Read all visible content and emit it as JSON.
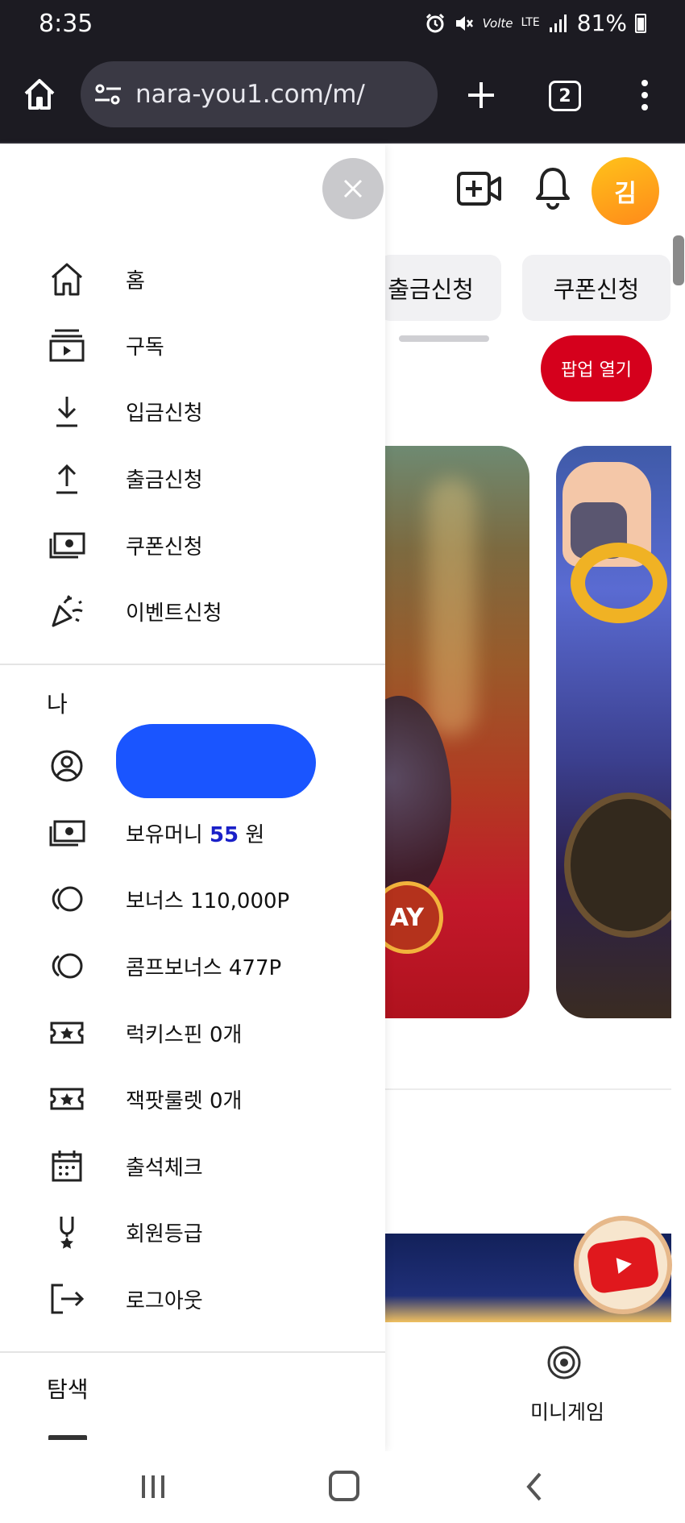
{
  "status_bar": {
    "time": "8:35",
    "battery": "81%",
    "network": "LTE",
    "volte": "Volte"
  },
  "browser": {
    "url": "nara-you1.com/m/",
    "tab_count": "2"
  },
  "header": {
    "avatar_initial": "김"
  },
  "chips": {
    "withdraw": "출금신청",
    "coupon": "쿠폰신청"
  },
  "popup_button": "팝업 열기",
  "banner": {
    "badge_text": "AY"
  },
  "bottom": {
    "mini_game": "미니게임"
  },
  "drawer": {
    "main_menu": [
      {
        "label": "홈",
        "icon": "home-icon"
      },
      {
        "label": "구독",
        "icon": "subscriptions-icon"
      },
      {
        "label": "입금신청",
        "icon": "download-icon"
      },
      {
        "label": "출금신청",
        "icon": "upload-icon"
      },
      {
        "label": "쿠폰신청",
        "icon": "money-icon"
      },
      {
        "label": "이벤트신청",
        "icon": "party-popper-icon"
      }
    ],
    "me_section": {
      "title": "나",
      "money_label": "보유머니",
      "money_value": "55",
      "money_unit": "원",
      "bonus": "보너스 110,000P",
      "comp_bonus": "콤프보너스 477P",
      "lucky_spin": "럭키스핀 0개",
      "jackpot": "잭팟룰렛 0개",
      "attendance": "출석체크",
      "membership": "회원등급",
      "logout": "로그아웃"
    },
    "explore_title": "탐색"
  },
  "colors": {
    "accent_red": "#d5001c",
    "money_blue": "#1a20c8",
    "browser_dark": "#1c1b22",
    "avatar_orange": "#ffb020"
  }
}
